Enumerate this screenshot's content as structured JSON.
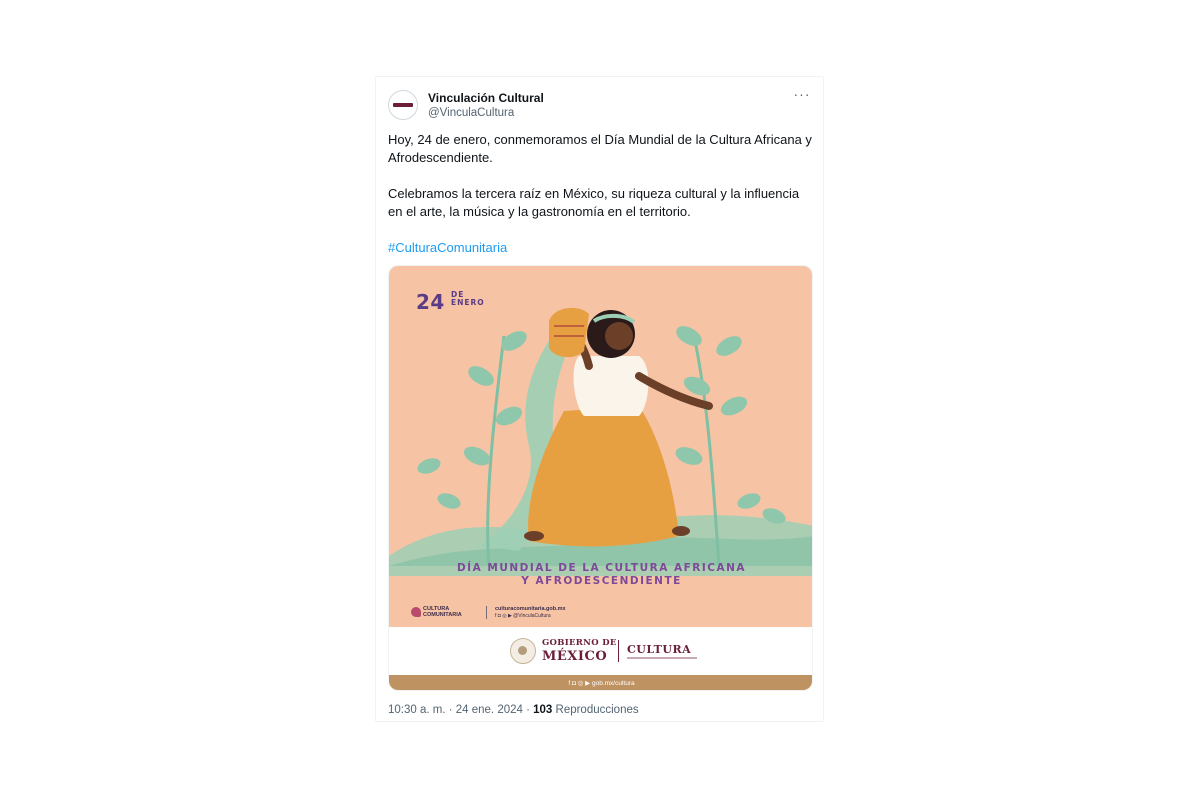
{
  "account": {
    "name": "Vinculación Cultural",
    "handle": "@VinculaCultura"
  },
  "more_icon": "more-horizontal-icon",
  "tweet": {
    "line1": "Hoy, 24 de enero, conmemoramos el Día Mundial de la Cultura Africana y Afrodescendiente.",
    "line2": "Celebramos la tercera raíz en México, su riqueza cultural y la influencia en el arte, la música y la gastronomía en el territorio.",
    "hashtag": "#CulturaComunitaria"
  },
  "poster": {
    "date_number": "24",
    "date_month_1": "DE",
    "date_month_2": "ENERO",
    "headline_1": "DÍA MUNDIAL DE LA CULTURA AFRICANA",
    "headline_2": "Y AFRODESCENDIENTE",
    "cc_logo_1": "CULTURA",
    "cc_logo_2": "COMUNITARIA",
    "cc_url": "culturacomunitaria.gob.mx",
    "cc_social": "f ◘ ◎ ▶ @VinculaCultura",
    "gov_line_1": "GOBIERNO DE",
    "gov_line_2": "MÉXICO",
    "cultura": "CULTURA",
    "footer": "f ◘ ◎ ▶  gob.mx/cultura",
    "colors": {
      "background": "#f6c4a4",
      "purple_text": "#5a3b86",
      "skirt": "#e6a041",
      "leaves": "#9dcfb5",
      "gov_maroon": "#6b1f36",
      "footer_gold": "#bf9261"
    }
  },
  "meta": {
    "time": "10:30 a. m. · 24 ene. 2024 · ",
    "views_count": "103",
    "views_label": " Reproducciones"
  }
}
